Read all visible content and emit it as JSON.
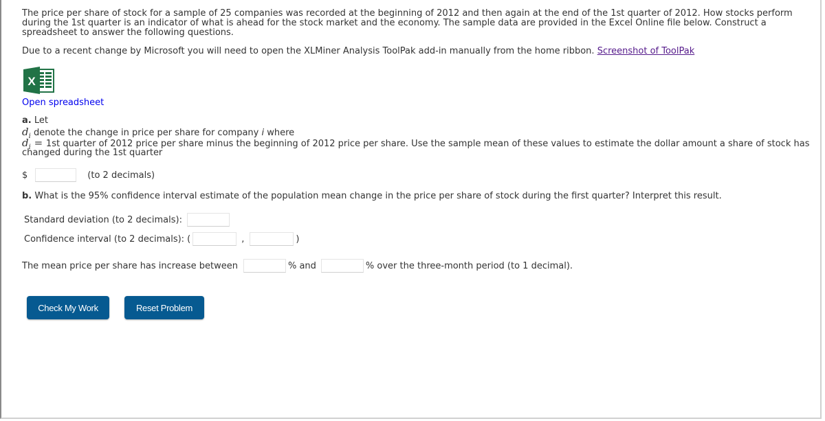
{
  "intro": {
    "text": "The price per share of stock for a sample of 25 companies was recorded at the beginning of 2012 and then again at the end of the 1st quarter of 2012. How stocks perform during the 1st quarter is an indicator of what is ahead for the stock market and the economy. The sample data are provided in the Excel Online file below. Construct a spreadsheet to answer the following questions."
  },
  "notice": {
    "text": "Due to a recent change by Microsoft you will need to open the XLMiner Analysis ToolPak add-in manually from the home ribbon. ",
    "link": "Screenshot of ToolPak"
  },
  "spreadsheet": {
    "icon": "excel-icon",
    "icon_color": "#217346",
    "link": "Open spreadsheet"
  },
  "part_a": {
    "label": "a.",
    "let": " Let",
    "var": "d",
    "sub": "i",
    "line2_a": " denote the change in price per share for company ",
    "line2_i": "i",
    "line2_b": " where",
    "eq": " = ",
    "line3": "1st quarter of 2012 price per share minus the beginning of 2012 price per share. Use the sample mean of these values to estimate the dollar amount a share of stock has",
    "line4": "changed during the 1st quarter",
    "currency": "$",
    "hint": "(to 2 decimals)",
    "mean_value": ""
  },
  "part_b": {
    "label": "b.",
    "question": " What is the 95% confidence interval estimate of the population mean change in the price per share of stock during the first quarter? Interpret this result.",
    "sd_label": "Standard deviation (to 2 decimals):",
    "sd_value": "",
    "ci_label": "Confidence interval (to 2 decimals): (",
    "ci_sep": ",",
    "ci_close": ")",
    "ci_low": "",
    "ci_high": "",
    "interp_a": "The mean price per share has increase between",
    "interp_b": "% and",
    "interp_c": "% over the three-month period (to 1 decimal).",
    "pct_low": "",
    "pct_high": ""
  },
  "buttons": {
    "check": "Check My Work",
    "reset": "Reset Problem",
    "color": "#065a91"
  }
}
